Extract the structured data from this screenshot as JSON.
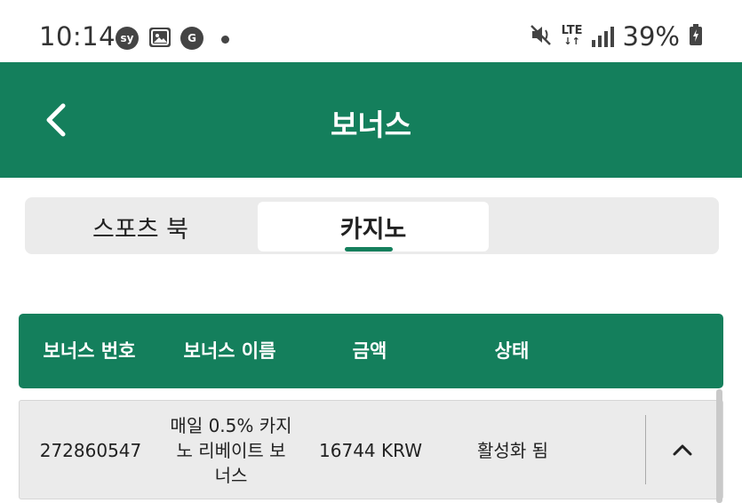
{
  "status_bar": {
    "time": "10:14",
    "notif_sy": "sy",
    "notif_g": "G",
    "network": "LTE",
    "battery": "39%"
  },
  "header": {
    "title": "보너스"
  },
  "tabs": [
    {
      "label": "스포츠 북",
      "selected": false
    },
    {
      "label": "카지노",
      "selected": true
    }
  ],
  "table": {
    "columns": [
      "보너스 번호",
      "보너스 이름",
      "금액",
      "상태"
    ],
    "rows": [
      {
        "number": "272860547",
        "name": "매일 0.5% 카지노 리베이트 보너스",
        "amount": "16744 KRW",
        "status": "활성화 됨"
      }
    ]
  },
  "colors": {
    "brand_green": "#147f5c",
    "tab_bg": "#ebebeb",
    "row_bg": "#ebebeb"
  },
  "icons": {
    "back": "chevron-left-icon",
    "expand": "chevron-up-icon"
  }
}
